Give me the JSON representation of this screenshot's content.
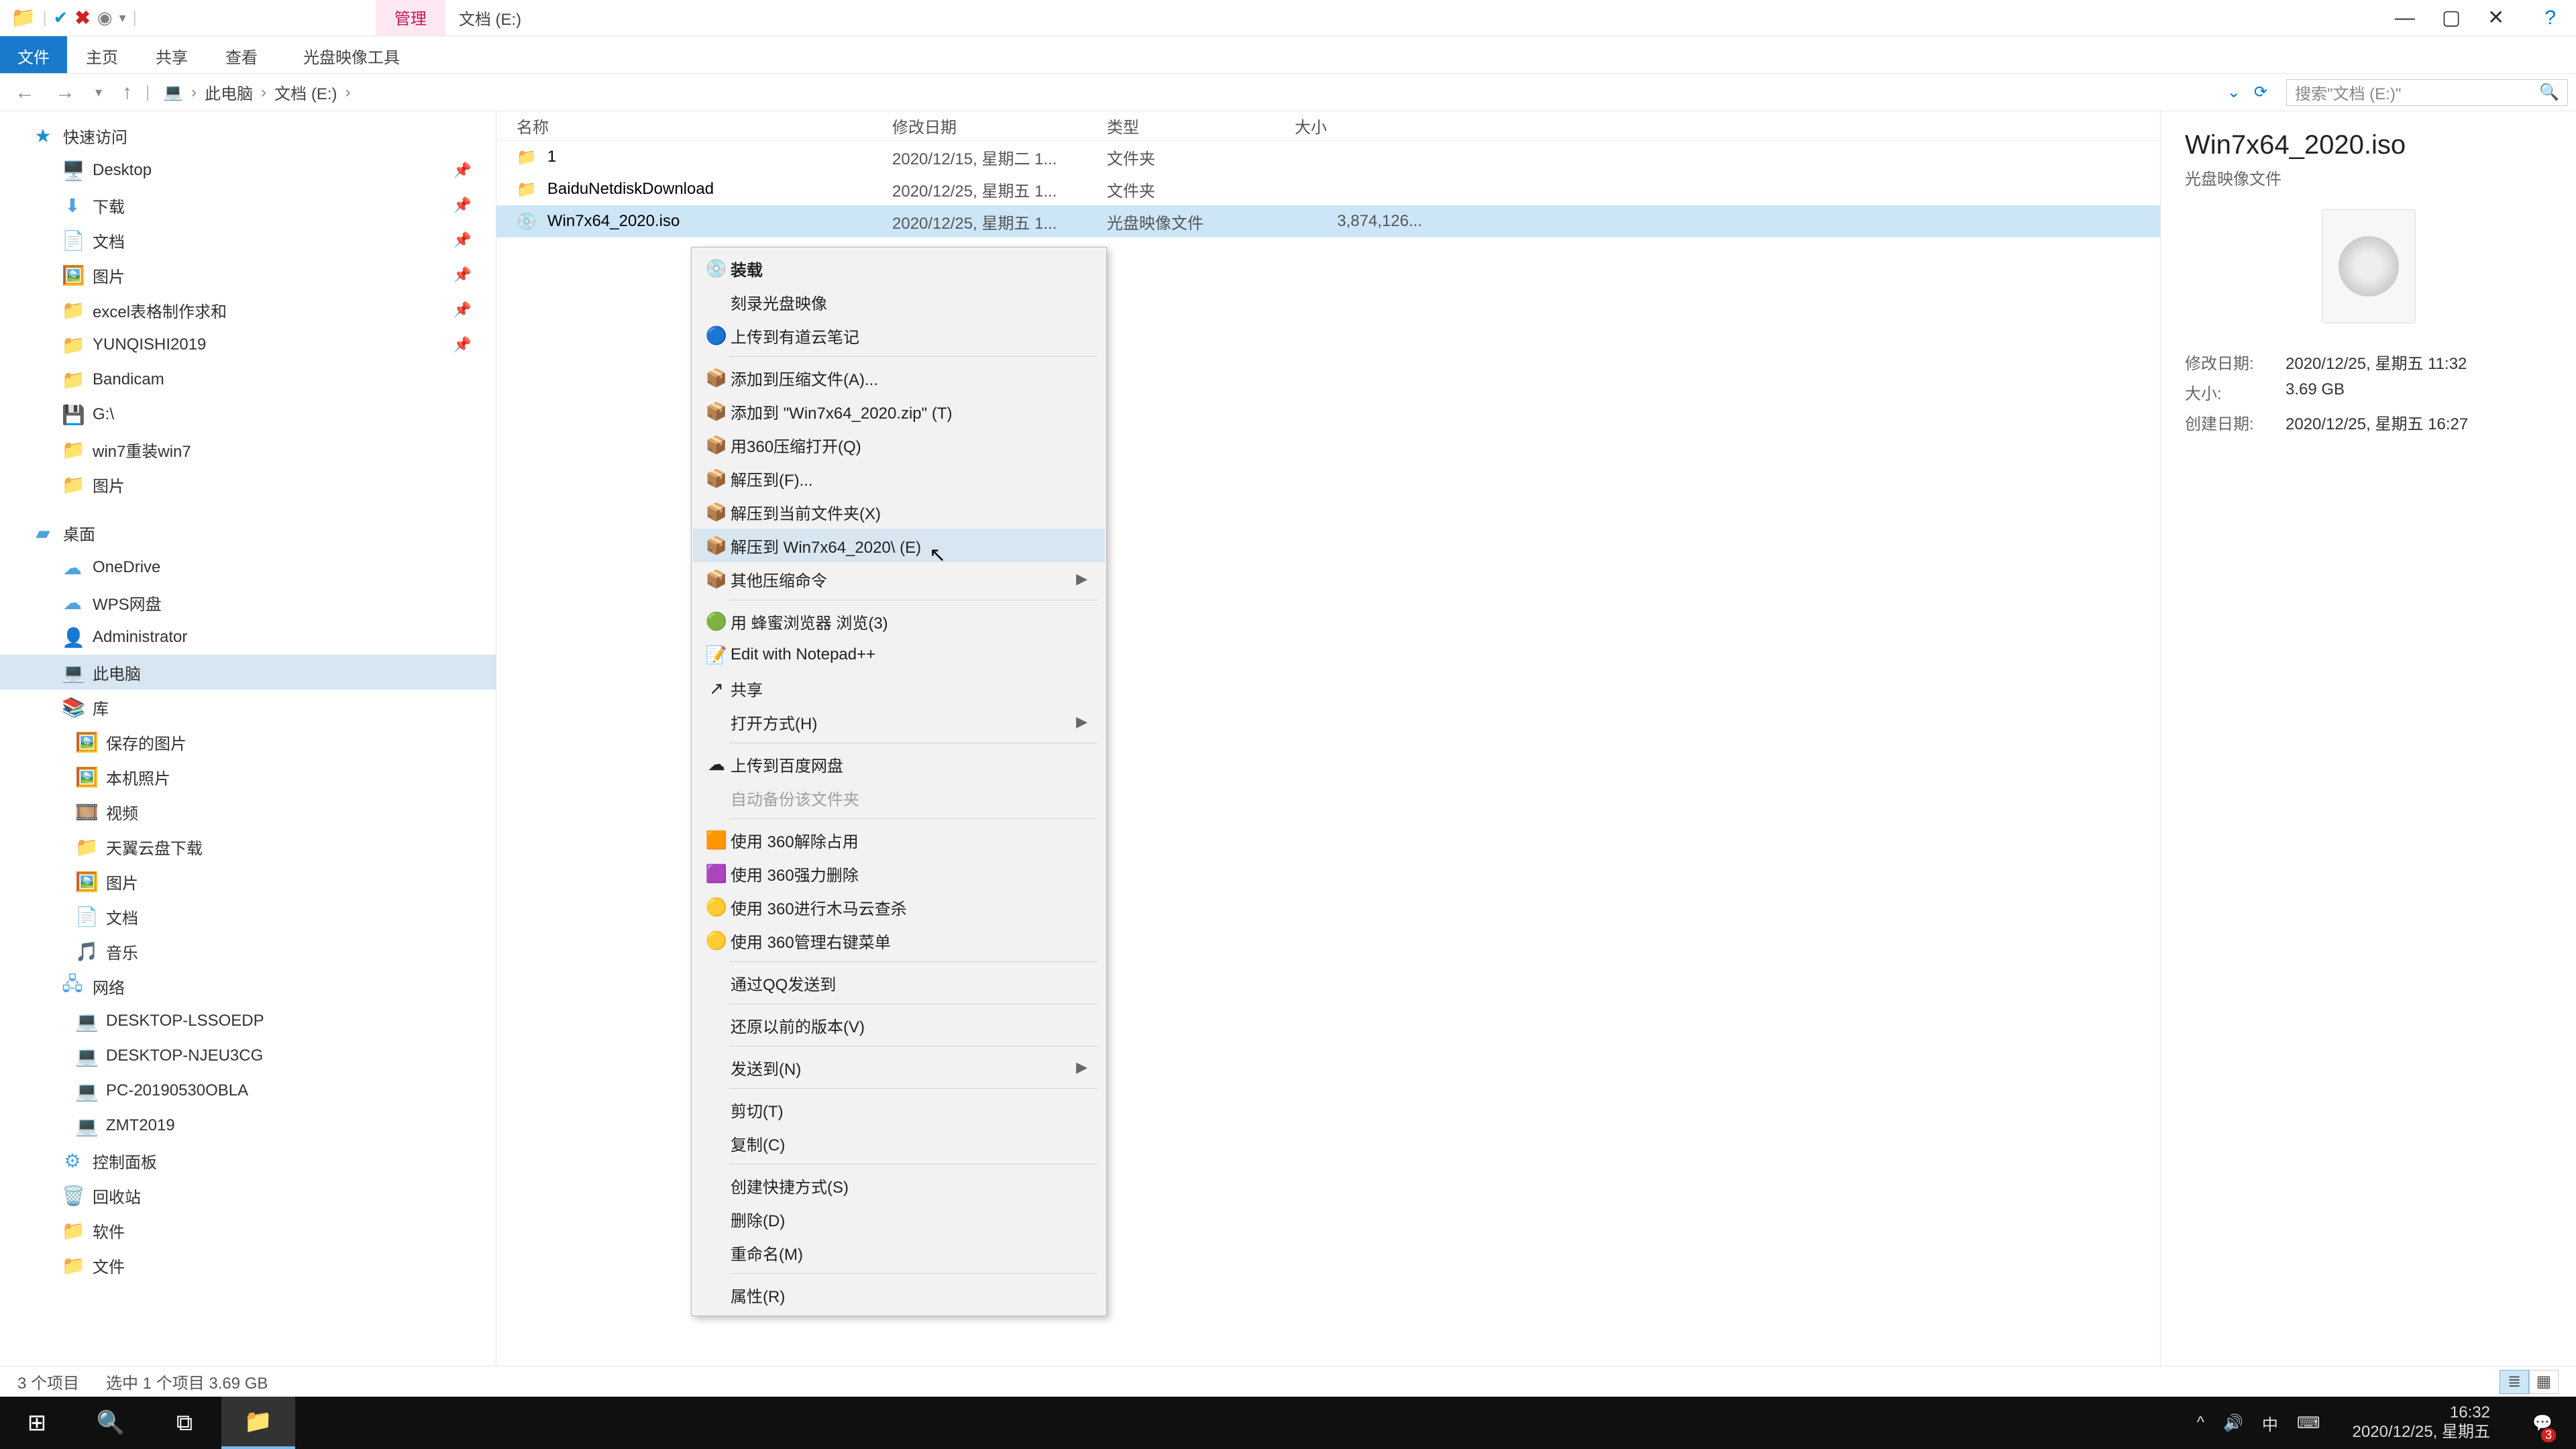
{
  "window": {
    "context_tab": "管理",
    "title": "文档 (E:)",
    "ribbon": {
      "file": "文件",
      "home": "主页",
      "share": "共享",
      "view": "查看",
      "iso_tools": "光盘映像工具"
    }
  },
  "nav": {
    "back": "←",
    "forward": "→",
    "up": "↑",
    "crumbs": [
      "此电脑",
      "文档 (E:)"
    ],
    "search_placeholder": "搜索\"文档 (E:)\""
  },
  "tree": {
    "quick_access": "快速访问",
    "items_qa": [
      {
        "icon": "🖥️",
        "label": "Desktop",
        "pin": true,
        "cls": "blue"
      },
      {
        "icon": "⬇",
        "label": "下载",
        "pin": true,
        "cls": "blue"
      },
      {
        "icon": "📄",
        "label": "文档",
        "pin": true,
        "cls": "blue"
      },
      {
        "icon": "🖼️",
        "label": "图片",
        "pin": true,
        "cls": "blue"
      },
      {
        "icon": "📁",
        "label": "excel表格制作求和",
        "pin": true,
        "cls": "yellow"
      },
      {
        "icon": "📁",
        "label": "YUNQISHI2019",
        "pin": true,
        "cls": "yellow"
      },
      {
        "icon": "📁",
        "label": "Bandicam",
        "pin": false,
        "cls": "yellow"
      },
      {
        "icon": "💾",
        "label": "G:\\",
        "pin": false,
        "cls": "grey"
      },
      {
        "icon": "📁",
        "label": "win7重装win7",
        "pin": false,
        "cls": "yellow"
      },
      {
        "icon": "📁",
        "label": "图片",
        "pin": false,
        "cls": "yellow"
      }
    ],
    "desktop_root": "桌面",
    "items_desktop": [
      {
        "icon": "☁",
        "label": "OneDrive",
        "cls": "blue"
      },
      {
        "icon": "☁",
        "label": "WPS网盘",
        "cls": "blue"
      },
      {
        "icon": "👤",
        "label": "Administrator",
        "cls": "grey"
      },
      {
        "icon": "💻",
        "label": "此电脑",
        "cls": "dark",
        "selected": true
      },
      {
        "icon": "📚",
        "label": "库",
        "cls": "green"
      }
    ],
    "items_lib": [
      {
        "icon": "🖼️",
        "label": "保存的图片"
      },
      {
        "icon": "🖼️",
        "label": "本机照片"
      },
      {
        "icon": "🎞️",
        "label": "视频"
      },
      {
        "icon": "📁",
        "label": "天翼云盘下载"
      },
      {
        "icon": "🖼️",
        "label": "图片"
      },
      {
        "icon": "📄",
        "label": "文档"
      },
      {
        "icon": "🎵",
        "label": "音乐"
      }
    ],
    "network": "网络",
    "items_net": [
      {
        "icon": "💻",
        "label": "DESKTOP-LSSOEDP"
      },
      {
        "icon": "💻",
        "label": "DESKTOP-NJEU3CG"
      },
      {
        "icon": "💻",
        "label": "PC-20190530OBLA"
      },
      {
        "icon": "💻",
        "label": "ZMT2019"
      }
    ],
    "items_tail": [
      {
        "icon": "⚙",
        "label": "控制面板",
        "cls": "blue"
      },
      {
        "icon": "🗑️",
        "label": "回收站",
        "cls": "grey"
      },
      {
        "icon": "📁",
        "label": "软件",
        "cls": "yellow"
      },
      {
        "icon": "📁",
        "label": "文件",
        "cls": "yellow"
      }
    ]
  },
  "columns": {
    "name": "名称",
    "modified": "修改日期",
    "type": "类型",
    "size": "大小"
  },
  "rows": [
    {
      "icon": "📁",
      "name": "1",
      "mod": "2020/12/15, 星期二 1...",
      "type": "文件夹",
      "size": ""
    },
    {
      "icon": "📁",
      "name": "BaiduNetdiskDownload",
      "mod": "2020/12/25, 星期五 1...",
      "type": "文件夹",
      "size": ""
    },
    {
      "icon": "💿",
      "name": "Win7x64_2020.iso",
      "mod": "2020/12/25, 星期五 1...",
      "type": "光盘映像文件",
      "size": "3,874,126...",
      "selected": true
    }
  ],
  "details": {
    "title": "Win7x64_2020.iso",
    "subtype": "光盘映像文件",
    "props": [
      {
        "k": "修改日期:",
        "v": "2020/12/25, 星期五 11:32"
      },
      {
        "k": "大小:",
        "v": "3.69 GB"
      },
      {
        "k": "创建日期:",
        "v": "2020/12/25, 星期五 16:27"
      }
    ]
  },
  "context_menu": [
    {
      "icon": "💿",
      "label": "装载",
      "bold": true
    },
    {
      "icon": "",
      "label": "刻录光盘映像"
    },
    {
      "icon": "🔵",
      "label": "上传到有道云笔记",
      "iconColor": "#1e88e5"
    },
    {
      "sep": true
    },
    {
      "icon": "📦",
      "label": "添加到压缩文件(A)..."
    },
    {
      "icon": "📦",
      "label": "添加到 \"Win7x64_2020.zip\" (T)"
    },
    {
      "icon": "📦",
      "label": "用360压缩打开(Q)"
    },
    {
      "icon": "📦",
      "label": "解压到(F)..."
    },
    {
      "icon": "📦",
      "label": "解压到当前文件夹(X)"
    },
    {
      "icon": "📦",
      "label": "解压到 Win7x64_2020\\ (E)",
      "hover": true
    },
    {
      "icon": "📦",
      "label": "其他压缩命令",
      "arrow": true
    },
    {
      "sep": true
    },
    {
      "icon": "🟢",
      "label": "用 蜂蜜浏览器 浏览(3)"
    },
    {
      "icon": "📝",
      "label": "Edit with Notepad++"
    },
    {
      "icon": "↗",
      "label": "共享"
    },
    {
      "icon": "",
      "label": "打开方式(H)",
      "arrow": true
    },
    {
      "sep": true
    },
    {
      "icon": "☁",
      "label": "上传到百度网盘"
    },
    {
      "icon": "",
      "label": "自动备份该文件夹",
      "disabled": true
    },
    {
      "sep": true
    },
    {
      "icon": "🟧",
      "label": "使用 360解除占用"
    },
    {
      "icon": "🟪",
      "label": "使用 360强力删除"
    },
    {
      "icon": "🟡",
      "label": "使用 360进行木马云查杀"
    },
    {
      "icon": "🟡",
      "label": "使用 360管理右键菜单"
    },
    {
      "sep": true
    },
    {
      "icon": "",
      "label": "通过QQ发送到"
    },
    {
      "sep": true
    },
    {
      "icon": "",
      "label": "还原以前的版本(V)"
    },
    {
      "sep": true
    },
    {
      "icon": "",
      "label": "发送到(N)",
      "arrow": true
    },
    {
      "sep": true
    },
    {
      "icon": "",
      "label": "剪切(T)"
    },
    {
      "icon": "",
      "label": "复制(C)"
    },
    {
      "sep": true
    },
    {
      "icon": "",
      "label": "创建快捷方式(S)"
    },
    {
      "icon": "",
      "label": "删除(D)"
    },
    {
      "icon": "",
      "label": "重命名(M)"
    },
    {
      "sep": true
    },
    {
      "icon": "",
      "label": "属性(R)"
    }
  ],
  "status": {
    "count": "3 个项目",
    "selection": "选中 1 个项目  3.69 GB"
  },
  "taskbar": {
    "time": "16:32",
    "date": "2020/12/25, 星期五",
    "ime": "中",
    "notif_count": "3"
  }
}
